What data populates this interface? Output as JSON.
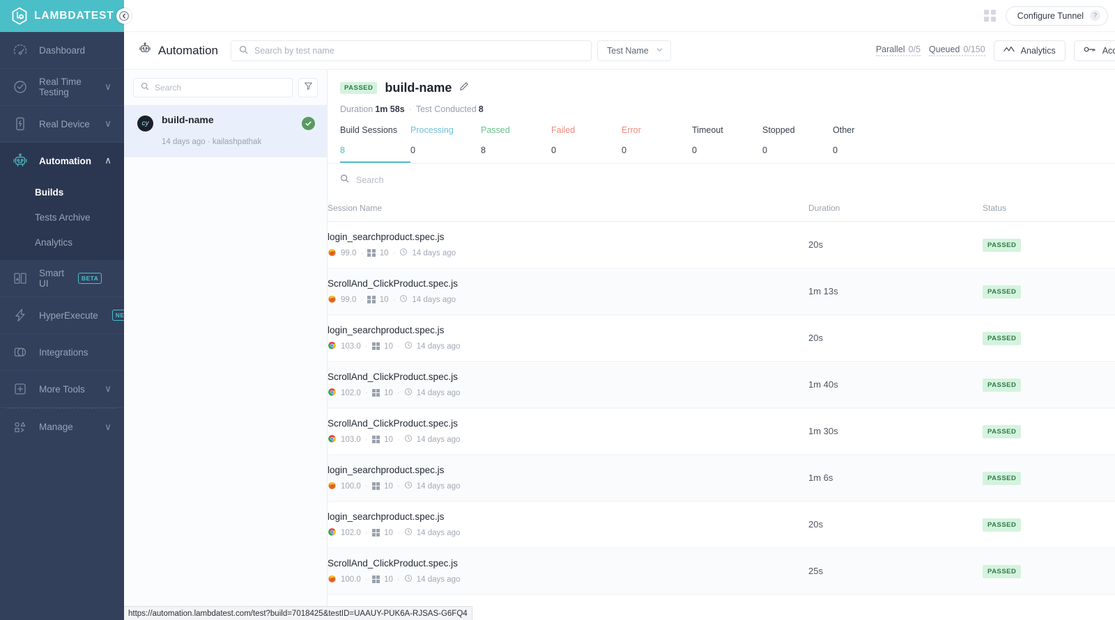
{
  "sidebar": {
    "brand": "LAMBDATEST",
    "collapse_icon": "chevron-left-icon",
    "items": [
      {
        "label": "Dashboard",
        "icon": "gauge-icon",
        "chevron": "",
        "active": false
      },
      {
        "label": "Real Time Testing",
        "icon": "clock-check-icon",
        "chevron": "∨",
        "active": false
      },
      {
        "label": "Real Device",
        "icon": "mobile-device-icon",
        "chevron": "∨",
        "active": false
      },
      {
        "label": "Automation",
        "icon": "robot-icon",
        "chevron": "∧",
        "active": true
      }
    ],
    "sub_items": [
      {
        "label": "Builds",
        "current": true
      },
      {
        "label": "Tests Archive",
        "current": false
      },
      {
        "label": "Analytics",
        "current": false
      }
    ],
    "items2": [
      {
        "label": "Smart UI",
        "icon": "smart-ui-icon",
        "badge": "BETA",
        "chevron": ""
      },
      {
        "label": "HyperExecute",
        "icon": "lightning-icon",
        "badge": "NEW",
        "chevron": ""
      },
      {
        "label": "Integrations",
        "icon": "integrations-icon",
        "badge": "",
        "chevron": ""
      },
      {
        "label": "More Tools",
        "icon": "plus-box-icon",
        "badge": "",
        "chevron": "∨"
      },
      {
        "label": "Manage",
        "icon": "manage-shapes-icon",
        "badge": "",
        "chevron": "∨"
      }
    ]
  },
  "topbar": {
    "grid_icon": "app-grid-icon",
    "configure_tunnel": "Configure Tunnel",
    "help_icon": "?"
  },
  "subbar": {
    "page_title": "Automation",
    "page_icon": "robot-icon",
    "search_placeholder": "Search by test name",
    "search_value": "",
    "search_icon": "search-icon",
    "filter_select": "Test Name",
    "parallel_label": "Parallel",
    "parallel_value": "0/5",
    "queued_label": "Queued",
    "queued_value": "0/150",
    "analytics_label": "Analytics",
    "analytics_icon": "line-chart-icon",
    "access_label": "Access",
    "access_icon": "key-icon"
  },
  "buildpanel": {
    "search_placeholder": "Search",
    "search_value": "",
    "search_icon": "search-icon",
    "filter_icon": "funnel-icon",
    "builds": [
      {
        "framework_icon": "cypress-logo",
        "framework_short": "cy",
        "name": "build-name",
        "meta": "14 days ago  ·  kailashpathak",
        "status_icon": "check-circle-icon"
      }
    ]
  },
  "detail": {
    "status_tag": "PASSED",
    "title": "build-name",
    "edit_icon": "pencil-icon",
    "duration_label": "Duration",
    "duration_value": "1m 58s",
    "tests_label": "Test Conducted",
    "tests_value": "8",
    "tabs": [
      {
        "label": "Build Sessions",
        "value": "8",
        "selected": true,
        "color": "#4bbfc8"
      },
      {
        "label": "Processing",
        "value": "0",
        "selected": false,
        "color": "#6fc0d9"
      },
      {
        "label": "Passed",
        "value": "8",
        "selected": false,
        "color": "#6bbf8a"
      },
      {
        "label": "Failed",
        "value": "0",
        "selected": false,
        "color": "#ef8a7a"
      },
      {
        "label": "Error",
        "value": "0",
        "selected": false,
        "color": "#ef8a7a"
      },
      {
        "label": "Timeout",
        "value": "0",
        "selected": false,
        "color": "#37404d"
      },
      {
        "label": "Stopped",
        "value": "0",
        "selected": false,
        "color": "#37404d"
      },
      {
        "label": "Other",
        "value": "0",
        "selected": false,
        "color": "#37404d"
      }
    ],
    "table_search_placeholder": "Search",
    "table_search_value": "",
    "columns": [
      "Session Name",
      "Duration",
      "Status"
    ],
    "rows": [
      {
        "name": "login_searchproduct.spec.js",
        "browser": "firefox",
        "browser_version": "99.0",
        "os": "windows",
        "os_version": "10",
        "age": "14 days ago",
        "duration": "20s",
        "status": "PASSED"
      },
      {
        "name": "ScrollAnd_ClickProduct.spec.js",
        "browser": "firefox",
        "browser_version": "99.0",
        "os": "windows",
        "os_version": "10",
        "age": "14 days ago",
        "duration": "1m 13s",
        "status": "PASSED"
      },
      {
        "name": "login_searchproduct.spec.js",
        "browser": "chrome",
        "browser_version": "103.0",
        "os": "windows",
        "os_version": "10",
        "age": "14 days ago",
        "duration": "20s",
        "status": "PASSED"
      },
      {
        "name": "ScrollAnd_ClickProduct.spec.js",
        "browser": "chrome",
        "browser_version": "102.0",
        "os": "windows",
        "os_version": "10",
        "age": "14 days ago",
        "duration": "1m 40s",
        "status": "PASSED"
      },
      {
        "name": "ScrollAnd_ClickProduct.spec.js",
        "browser": "chrome",
        "browser_version": "103.0",
        "os": "windows",
        "os_version": "10",
        "age": "14 days ago",
        "duration": "1m 30s",
        "status": "PASSED"
      },
      {
        "name": "login_searchproduct.spec.js",
        "browser": "firefox",
        "browser_version": "100.0",
        "os": "windows",
        "os_version": "10",
        "age": "14 days ago",
        "duration": "1m 6s",
        "status": "PASSED"
      },
      {
        "name": "login_searchproduct.spec.js",
        "browser": "chrome",
        "browser_version": "102.0",
        "os": "windows",
        "os_version": "10",
        "age": "14 days ago",
        "duration": "20s",
        "status": "PASSED"
      },
      {
        "name": "ScrollAnd_ClickProduct.spec.js",
        "browser": "firefox",
        "browser_version": "100.0",
        "os": "windows",
        "os_version": "10",
        "age": "14 days ago",
        "duration": "25s",
        "status": "PASSED"
      }
    ]
  },
  "status_url": "https://automation.lambdatest.com/test?build=7018425&testID=UAAUY-PUK6A-RJSAS-G6FQ4"
}
